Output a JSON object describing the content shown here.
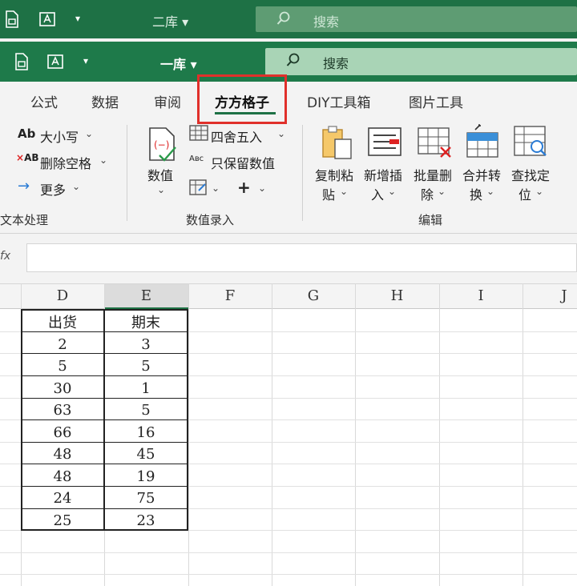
{
  "titlebar1": {
    "doc_name": "二库 ▾",
    "search_label": "搜索"
  },
  "titlebar2": {
    "doc_name": "一库 ▾",
    "search_label": "搜索"
  },
  "tabs": [
    {
      "label": "公式"
    },
    {
      "label": "数据"
    },
    {
      "label": "审阅"
    },
    {
      "label": "方方格子",
      "active": true
    },
    {
      "label": "DIY工具箱"
    },
    {
      "label": "图片工具"
    }
  ],
  "ribbon": {
    "text_group": {
      "case_label": "大小写",
      "remove_space_label": "删除空格",
      "more_label": "更多",
      "group_label": "文本处理"
    },
    "number_group": {
      "value_label": "数值",
      "round_label": "四舍五入",
      "keep_value_label": "只保留数值",
      "group_label": "数值录入"
    },
    "edit_group": {
      "copy_paste_label_1": "复制粘",
      "copy_paste_label_2": "贴",
      "insert_label_1": "新增插",
      "insert_label_2": "入",
      "batch_delete_label_1": "批量删",
      "batch_delete_label_2": "除",
      "merge_label_1": "合并转",
      "merge_label_2": "换",
      "find_label_1": "查找定",
      "find_label_2": "位",
      "group_label": "编辑"
    }
  },
  "formula_bar": {
    "fx_label": "fx"
  },
  "columns": [
    "D",
    "E",
    "F",
    "G",
    "H",
    "I",
    "J"
  ],
  "table": {
    "headers": [
      "出货",
      "期末"
    ],
    "rows": [
      [
        "2",
        "3"
      ],
      [
        "5",
        "5"
      ],
      [
        "30",
        "1"
      ],
      [
        "63",
        "5"
      ],
      [
        "66",
        "16"
      ],
      [
        "48",
        "45"
      ],
      [
        "48",
        "19"
      ],
      [
        "24",
        "75"
      ],
      [
        "25",
        "23"
      ]
    ]
  },
  "colors": {
    "title_green": "#1e7145",
    "highlight_red": "#e0302b"
  }
}
